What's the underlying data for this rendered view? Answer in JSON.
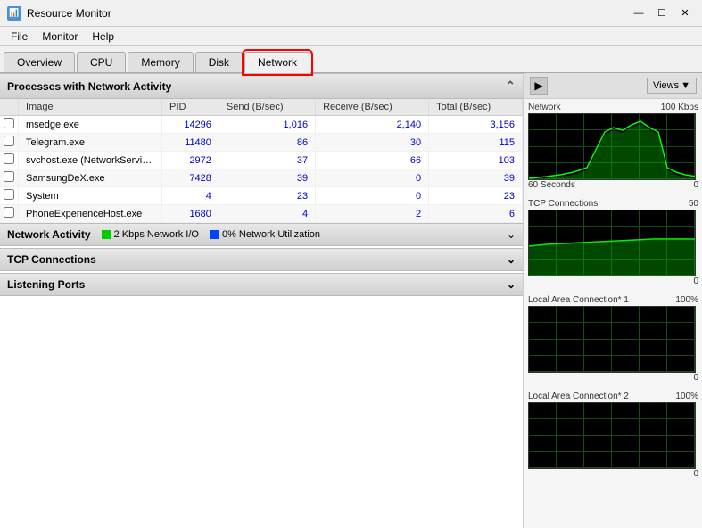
{
  "window": {
    "title": "Resource Monitor",
    "controls": {
      "minimize": "—",
      "maximize": "☐",
      "close": "✕"
    }
  },
  "menu": {
    "items": [
      "File",
      "Monitor",
      "Help"
    ]
  },
  "tabs": [
    {
      "label": "Overview",
      "active": false
    },
    {
      "label": "CPU",
      "active": false
    },
    {
      "label": "Memory",
      "active": false
    },
    {
      "label": "Disk",
      "active": false
    },
    {
      "label": "Network",
      "active": true,
      "highlighted": true
    }
  ],
  "processes_section": {
    "title": "Processes with Network Activity",
    "columns": {
      "image": "Image",
      "pid": "PID",
      "send": "Send (B/sec)",
      "receive": "Receive (B/sec)",
      "total": "Total (B/sec)"
    },
    "rows": [
      {
        "image": "msedge.exe",
        "pid": "14296",
        "send": "1,016",
        "receive": "2,140",
        "total": "3,156"
      },
      {
        "image": "Telegram.exe",
        "pid": "11480",
        "send": "86",
        "receive": "30",
        "total": "115"
      },
      {
        "image": "svchost.exe (NetworkService...",
        "pid": "2972",
        "send": "37",
        "receive": "66",
        "total": "103"
      },
      {
        "image": "SamsungDeX.exe",
        "pid": "7428",
        "send": "39",
        "receive": "0",
        "total": "39"
      },
      {
        "image": "System",
        "pid": "4",
        "send": "23",
        "receive": "0",
        "total": "23"
      },
      {
        "image": "PhoneExperienceHost.exe",
        "pid": "1680",
        "send": "4",
        "receive": "2",
        "total": "6"
      }
    ]
  },
  "network_activity": {
    "title": "Network Activity",
    "network_io": "2 Kbps Network I/O",
    "network_util": "0% Network Utilization"
  },
  "tcp_section": {
    "title": "TCP Connections"
  },
  "listening_ports": {
    "title": "Listening Ports"
  },
  "right_panel": {
    "views_label": "Views",
    "charts": [
      {
        "title": "Network",
        "scale": "100 Kbps",
        "bottom_left": "60 Seconds",
        "bottom_right": "0"
      },
      {
        "title": "TCP Connections",
        "scale": "50",
        "bottom_left": "",
        "bottom_right": "0"
      },
      {
        "title": "Local Area Connection* 1",
        "scale": "100%",
        "bottom_left": "",
        "bottom_right": "0"
      },
      {
        "title": "Local Area Connection* 2",
        "scale": "100%",
        "bottom_left": "",
        "bottom_right": "0"
      }
    ]
  }
}
